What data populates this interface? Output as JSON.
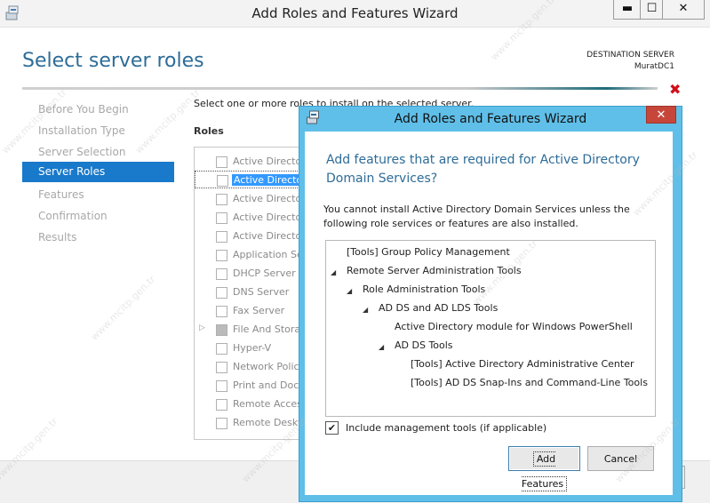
{
  "window": {
    "title": "Add Roles and Features Wizard",
    "minimize": "▬",
    "maximize": "☐",
    "close": "✕"
  },
  "page": {
    "title": "Select server roles",
    "destination_label": "DESTINATION SERVER",
    "destination_server": "MuratDC1",
    "instruction": "Select one or more roles to install on the selected server.",
    "roles_heading": "Roles"
  },
  "nav": [
    {
      "label": "Before You Begin",
      "active": false
    },
    {
      "label": "Installation Type",
      "active": false
    },
    {
      "label": "Server Selection",
      "active": false
    },
    {
      "label": "Server Roles",
      "active": true
    },
    {
      "label": "Features",
      "active": false
    },
    {
      "label": "Confirmation",
      "active": false
    },
    {
      "label": "Results",
      "active": false
    }
  ],
  "roles": [
    "Active Directo",
    "Active Directo",
    "Active Directo",
    "Active Directo",
    "Active Directo",
    "Application Se",
    "DHCP Server",
    "DNS Server",
    "Fax Server",
    "File And Stora",
    "Hyper-V",
    "Network Polic",
    "Print and Doc",
    "Remote Acces",
    "Remote Deskt"
  ],
  "dialog": {
    "title": "Add Roles and Features Wizard",
    "close": "✕",
    "heading": "Add features that are required for Active Directory Domain Services?",
    "message": "You cannot install Active Directory Domain Services unless the following role services or features are also installed.",
    "tree": [
      {
        "label": "[Tools] Group Policy Management",
        "level": 0,
        "expander": ""
      },
      {
        "label": "Remote Server Administration Tools",
        "level": 0,
        "expander": "◢"
      },
      {
        "label": "Role Administration Tools",
        "level": 1,
        "expander": "◢"
      },
      {
        "label": "AD DS and AD LDS Tools",
        "level": 2,
        "expander": "◢"
      },
      {
        "label": "Active Directory module for Windows PowerShell",
        "level": 3,
        "expander": ""
      },
      {
        "label": "AD DS Tools",
        "level": 3,
        "expander": "◢"
      },
      {
        "label": "[Tools] Active Directory Administrative Center",
        "level": 4,
        "expander": ""
      },
      {
        "label": "[Tools] AD DS Snap-Ins and Command-Line Tools",
        "level": 4,
        "expander": ""
      }
    ],
    "include_tools_label": "Include management tools (if applicable)",
    "include_tools_checked": true,
    "include_tools_mark": "✔",
    "add_button": "Add Features",
    "cancel_button": "Cancel"
  },
  "watermark": "www.mcitp.gen.tr",
  "colors": {
    "accent": "#1979ca",
    "title_blue": "#2d6c98",
    "dialog_frame": "#5fbfe8",
    "close_red": "#c7463a",
    "error_red": "#d0101c"
  }
}
